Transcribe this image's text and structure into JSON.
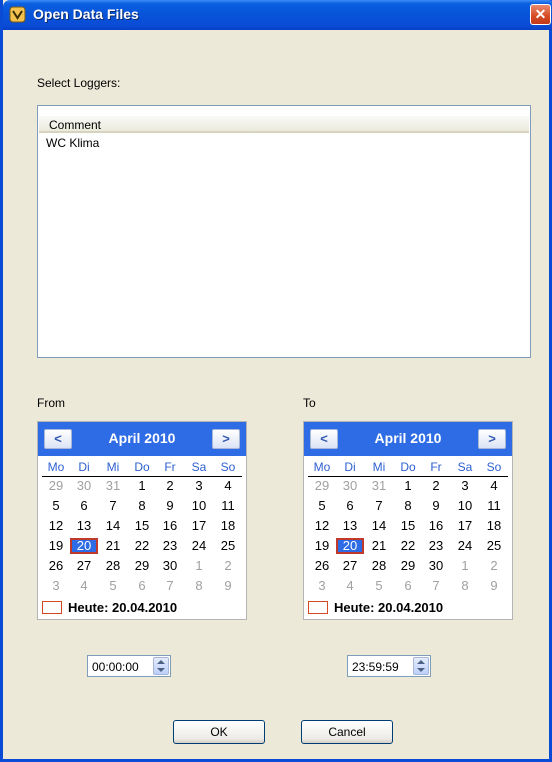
{
  "window": {
    "title": "Open Data Files",
    "close_glyph": "✕",
    "colors": {
      "titlebar": "#0a4bd6",
      "face": "#ece9d8",
      "calendar_header": "#2e6ce6"
    }
  },
  "loggers": {
    "label": "Select Loggers:",
    "columns": [
      "Comment"
    ],
    "rows": [
      {
        "comment": "WC Klima"
      }
    ]
  },
  "from": {
    "label": "From",
    "month_title": "April 2010",
    "prev_glyph": "<",
    "next_glyph": ">",
    "weekdays": [
      "Mo",
      "Di",
      "Mi",
      "Do",
      "Fr",
      "Sa",
      "So"
    ],
    "today_label": "Heute: 20.04.2010",
    "time": "00:00:00"
  },
  "to": {
    "label": "To",
    "month_title": "April 2010",
    "prev_glyph": "<",
    "next_glyph": ">",
    "weekdays": [
      "Mo",
      "Di",
      "Mi",
      "Do",
      "Fr",
      "Sa",
      "So"
    ],
    "today_label": "Heute: 20.04.2010",
    "time": "23:59:59"
  },
  "calendar_weeks": [
    [
      {
        "d": "29",
        "m": true
      },
      {
        "d": "30",
        "m": true
      },
      {
        "d": "31",
        "m": true
      },
      {
        "d": "1"
      },
      {
        "d": "2"
      },
      {
        "d": "3"
      },
      {
        "d": "4"
      }
    ],
    [
      {
        "d": "5"
      },
      {
        "d": "6"
      },
      {
        "d": "7"
      },
      {
        "d": "8"
      },
      {
        "d": "9"
      },
      {
        "d": "10"
      },
      {
        "d": "11"
      }
    ],
    [
      {
        "d": "12"
      },
      {
        "d": "13"
      },
      {
        "d": "14"
      },
      {
        "d": "15"
      },
      {
        "d": "16"
      },
      {
        "d": "17"
      },
      {
        "d": "18"
      }
    ],
    [
      {
        "d": "19"
      },
      {
        "d": "20",
        "s": true
      },
      {
        "d": "21"
      },
      {
        "d": "22"
      },
      {
        "d": "23"
      },
      {
        "d": "24"
      },
      {
        "d": "25"
      }
    ],
    [
      {
        "d": "26"
      },
      {
        "d": "27"
      },
      {
        "d": "28"
      },
      {
        "d": "29"
      },
      {
        "d": "30"
      },
      {
        "d": "1",
        "m": true
      },
      {
        "d": "2",
        "m": true
      }
    ],
    [
      {
        "d": "3",
        "m": true
      },
      {
        "d": "4",
        "m": true
      },
      {
        "d": "5",
        "m": true
      },
      {
        "d": "6",
        "m": true
      },
      {
        "d": "7",
        "m": true
      },
      {
        "d": "8",
        "m": true
      },
      {
        "d": "9",
        "m": true
      }
    ]
  ],
  "buttons": {
    "ok": "OK",
    "cancel": "Cancel"
  }
}
